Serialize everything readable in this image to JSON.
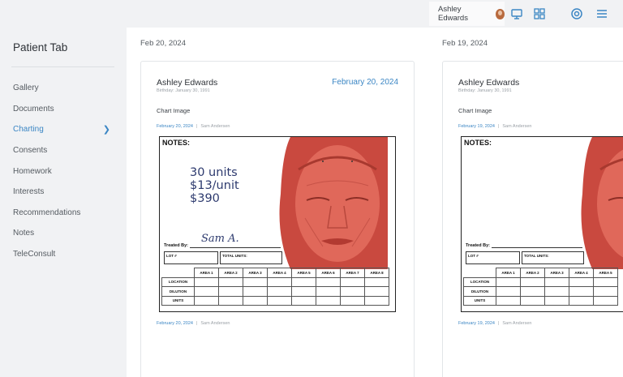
{
  "header": {
    "user_name": "Ashley Edwards",
    "icons": [
      "avatar",
      "monitor-icon",
      "grid-icon",
      "target-icon",
      "menu-icon"
    ]
  },
  "sidebar": {
    "title": "Patient Tab",
    "items": [
      {
        "label": "Gallery",
        "active": false
      },
      {
        "label": "Documents",
        "active": false
      },
      {
        "label": "Charting",
        "active": true
      },
      {
        "label": "Consents",
        "active": false
      },
      {
        "label": "Homework",
        "active": false
      },
      {
        "label": "Interests",
        "active": false
      },
      {
        "label": "Recommendations",
        "active": false
      },
      {
        "label": "Notes",
        "active": false
      },
      {
        "label": "TeleConsult",
        "active": false
      }
    ]
  },
  "entries": [
    {
      "day_label": "Feb 20, 2024",
      "patient": "Ashley Edwards",
      "birthday": "Birthday: January 30, 1991",
      "date": "February 20, 2024",
      "chart_label": "Chart Image",
      "meta_date": "February 20, 2024",
      "meta_author": "Sam Andersen",
      "form": {
        "notes": "NOTES:",
        "lines": [
          "30 units",
          "$13/unit",
          "$390"
        ],
        "treated_by": "Treated By:",
        "signature": "Sam A.",
        "lot": "LOT #",
        "total_units": "TOTAL UNITS:",
        "areas": [
          "AREA 1",
          "AREA 2",
          "AREA 3",
          "AREA 4",
          "AREA 5",
          "AREA 6",
          "AREA 7",
          "AREA 8"
        ],
        "rows": [
          "LOCATION",
          "DILUTION",
          "UNITS"
        ]
      }
    },
    {
      "day_label": "Feb 19, 2024",
      "patient": "Ashley Edwards",
      "birthday": "Birthday: January 30, 1991",
      "chart_label": "Chart Image",
      "meta_date": "February 19, 2024",
      "meta_author": "Sam Andersen",
      "form": {
        "notes": "NOTES:",
        "treated_by": "Treated By:",
        "lot": "LOT #",
        "total_units": "TOTAL UNITS:",
        "areas": [
          "AREA 1",
          "AREA 2",
          "AREA 3",
          "AREA 4",
          "AREA 5"
        ],
        "rows": [
          "LOCATION",
          "DILUTION",
          "UNITS"
        ]
      }
    }
  ],
  "colors": {
    "accent": "#3b86c4",
    "face": "#e0685a",
    "ink": "#2d3a6e"
  }
}
